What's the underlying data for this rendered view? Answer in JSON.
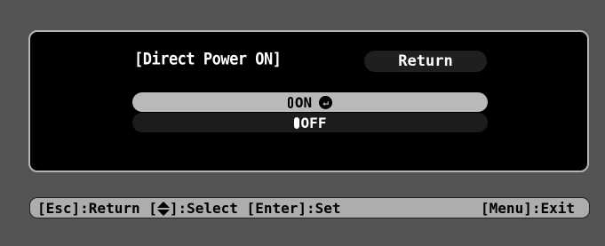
{
  "menu": {
    "title": "[Direct Power ON]",
    "return_label": "Return",
    "options": [
      {
        "label": "ON",
        "selected": true,
        "icon": "enter-icon"
      },
      {
        "label": "OFF",
        "selected": false
      }
    ]
  },
  "footer": {
    "esc_text": "[Esc]:Return [",
    "select_text": "]:Select [Enter]:Set",
    "menu_text": "[Menu]:Exit",
    "icon": "up-down-arrow-icon"
  }
}
